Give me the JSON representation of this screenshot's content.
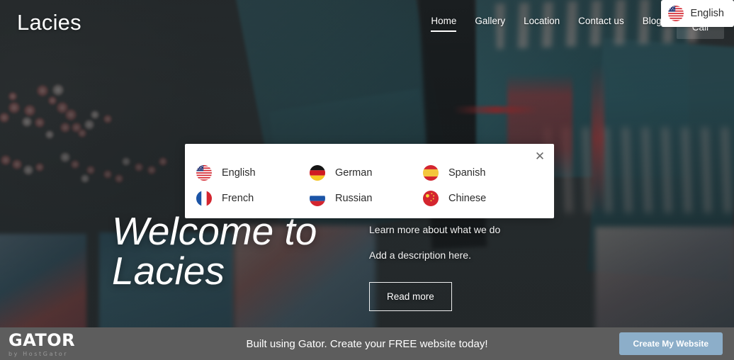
{
  "site": {
    "brand": "Lacies"
  },
  "header": {
    "nav_items": [
      {
        "label": "Home",
        "active": true
      },
      {
        "label": "Gallery",
        "active": false
      },
      {
        "label": "Location",
        "active": false
      },
      {
        "label": "Contact us",
        "active": false
      },
      {
        "label": "Blog",
        "active": false
      }
    ],
    "cta_label": "Call",
    "language_pill": {
      "label": "English",
      "flag": "us-flag-icon"
    }
  },
  "hero": {
    "title_line1": "Welcome to",
    "title_line2": "Lacies",
    "subtitle": "Learn more about what we do",
    "description": "Add a description here.",
    "button_label": "Read more"
  },
  "language_modal": {
    "close_label": "✕",
    "options": [
      {
        "label": "English",
        "flag": "us-flag-icon"
      },
      {
        "label": "German",
        "flag": "de-flag-icon"
      },
      {
        "label": "Spanish",
        "flag": "es-flag-icon"
      },
      {
        "label": "French",
        "flag": "fr-flag-icon"
      },
      {
        "label": "Russian",
        "flag": "ru-flag-icon"
      },
      {
        "label": "Chinese",
        "flag": "cn-flag-icon"
      }
    ]
  },
  "gator_bar": {
    "logo_word": "GATOR",
    "logo_sub": "by HostGator",
    "tagline": "Built using Gator. Create your FREE website today!",
    "cta_label": "Create My Website"
  },
  "colors": {
    "gator_bar_bg": "#5d5d5d",
    "gator_cta_bg": "#8caec9",
    "modal_bg": "#ffffff",
    "nav_text": "#ffffff"
  }
}
